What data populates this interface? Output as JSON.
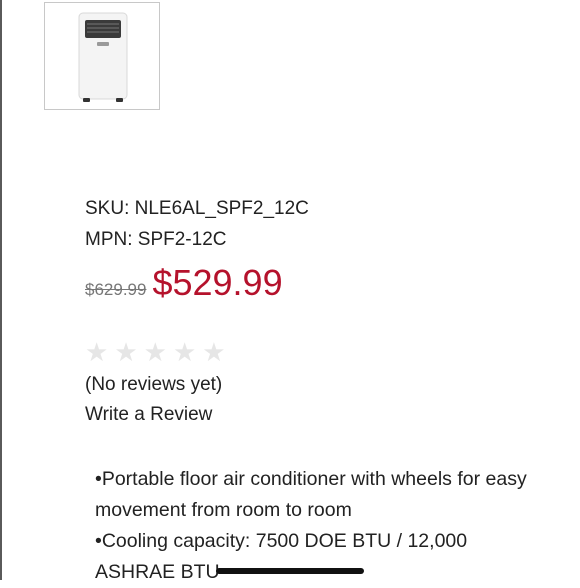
{
  "product": {
    "thumbnail_icon": "portable-air-conditioner-image",
    "sku": "SKU: NLE6AL_SPF2_12C",
    "mpn": "MPN: SPF2-12C",
    "original_price": "$629.99",
    "sale_price": "$529.99",
    "rating": {
      "stars_filled": 0,
      "stars_total": 5
    },
    "reviews_text": "(No reviews yet)",
    "write_review_label": "Write a Review",
    "description_lines": [
      "•Portable floor air conditioner with wheels for easy movement from room to room",
      "•Cooling capacity: 7500 DOE BTU / 12,000 ASHRAE BTU"
    ]
  },
  "colors": {
    "sale_price": "#b5122c",
    "empty_star": "#e6e6e6"
  }
}
